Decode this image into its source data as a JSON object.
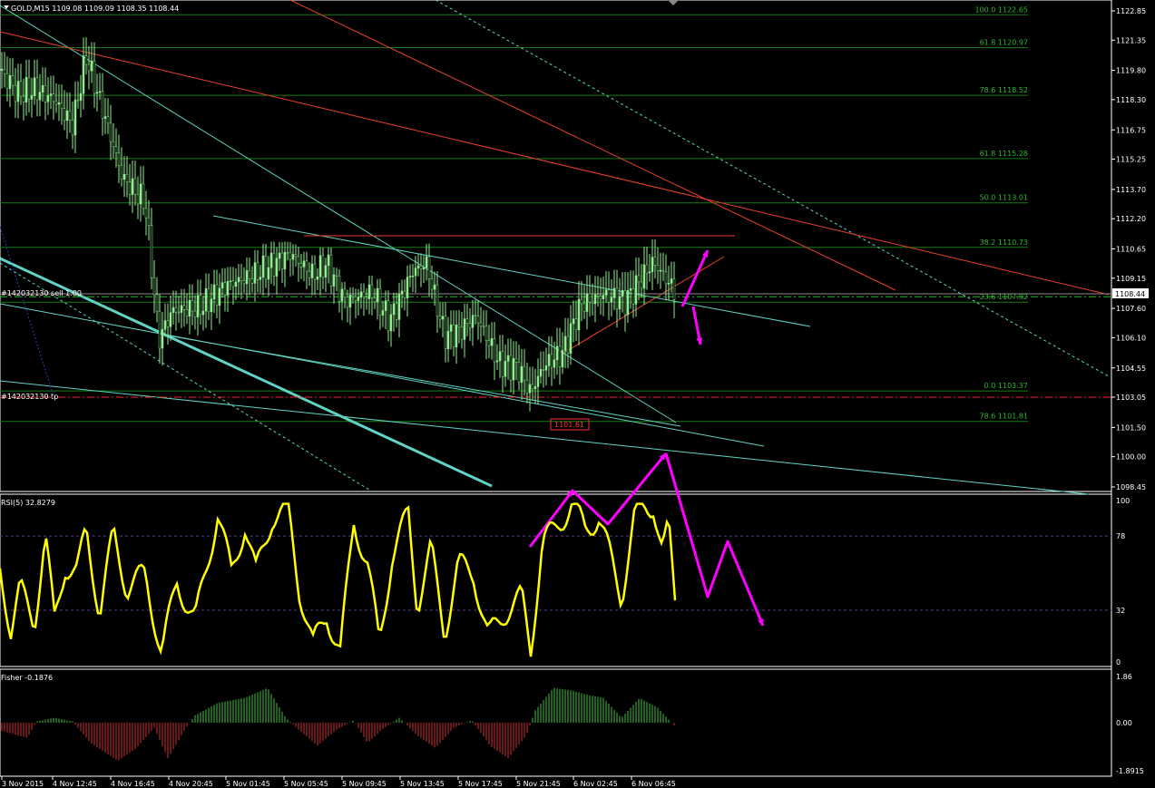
{
  "header": {
    "symbol": "GOLD,M15  1109.08 1109.09 1108.35 1108.44"
  },
  "colors": {
    "background": "#000000",
    "grid_text": "#ffffff",
    "fib": "#1a7a1a",
    "fib_text": "#2db52d",
    "trend_cyan": "#5fd3c4",
    "trend_red": "#e8402a",
    "bull": "#90ee90",
    "rsi": "#ffff00",
    "arrow": "#ff00ff",
    "fisher_up": "#3fbf3f",
    "fisher_down": "#d03030",
    "order_red": "#ff2222"
  },
  "price_pane": {
    "current_price": "1108.44",
    "low_marker": "1101.61",
    "axis_ticks": [
      "1122.85",
      "1121.35",
      "1119.80",
      "1118.30",
      "1116.75",
      "1115.25",
      "1113.70",
      "1112.20",
      "1110.65",
      "1109.15",
      "1107.60",
      "1106.10",
      "1104.55",
      "1103.05",
      "1101.50",
      "1100.00",
      "1098.45"
    ],
    "fib_levels": [
      {
        "label": "100.0  1122.65",
        "price": 1122.65
      },
      {
        "label": "61.8  1120.97",
        "price": 1120.97
      },
      {
        "label": "78.6  1118.52",
        "price": 1118.52
      },
      {
        "label": "61.8  1115.28",
        "price": 1115.28
      },
      {
        "label": "50.0   1113.01",
        "price": 1113.01
      },
      {
        "label": "38.2  1110.73",
        "price": 1110.73
      },
      {
        "label": "23.6  1107.92",
        "price": 1107.92
      },
      {
        "label": "0.0  1103.37",
        "price": 1103.37
      },
      {
        "label": "78.6  1101.81",
        "price": 1101.81
      }
    ],
    "orders": {
      "sell_label": "#142032130 sell 1.00",
      "sell_price": 1108.2,
      "tp_label": "#142032130 tp",
      "tp_price": 1103.05
    },
    "candles_ohlc_by_bar": "see script series"
  },
  "rsi_pane": {
    "header": "RSI(5) 32.8279",
    "current": 32.8279,
    "levels": [
      78,
      32
    ],
    "axis_ticks": [
      "100",
      "78",
      "32",
      "0"
    ],
    "ylim": [
      0,
      100
    ]
  },
  "fisher_pane": {
    "header": "Fisher -0.1876",
    "current": -0.1876,
    "axis_ticks": [
      "1.86",
      "0.00",
      "-1.8915"
    ],
    "ylim": [
      -1.8915,
      1.86
    ]
  },
  "time_axis": {
    "labels": [
      "3 Nov 2015",
      "4 Nov 12:45",
      "4 Nov 16:45",
      "4 Nov 20:45",
      "5 Nov 01:45",
      "5 Nov 05:45",
      "5 Nov 09:45",
      "5 Nov 13:45",
      "5 Nov 17:45",
      "5 Nov 21:45",
      "6 Nov 02:45",
      "6 Nov 06:45"
    ]
  },
  "chart_data": {
    "type": "line",
    "symbol": "GOLD",
    "timeframe": "M15",
    "panes": [
      "price-candlestick",
      "RSI(5)",
      "Fisher"
    ],
    "price_ylim": [
      1098.45,
      1122.85
    ],
    "rsi_ylim": [
      0,
      100
    ],
    "fisher_ylim": [
      -1.8915,
      1.86
    ],
    "x_tick_labels": [
      "3 Nov 2015",
      "4 Nov 12:45",
      "4 Nov 16:45",
      "4 Nov 20:45",
      "5 Nov 01:45",
      "5 Nov 05:45",
      "5 Nov 09:45",
      "5 Nov 13:45",
      "5 Nov 17:45",
      "5 Nov 21:45",
      "6 Nov 02:45",
      "6 Nov 06:45"
    ],
    "last_price": 1108.44
  }
}
